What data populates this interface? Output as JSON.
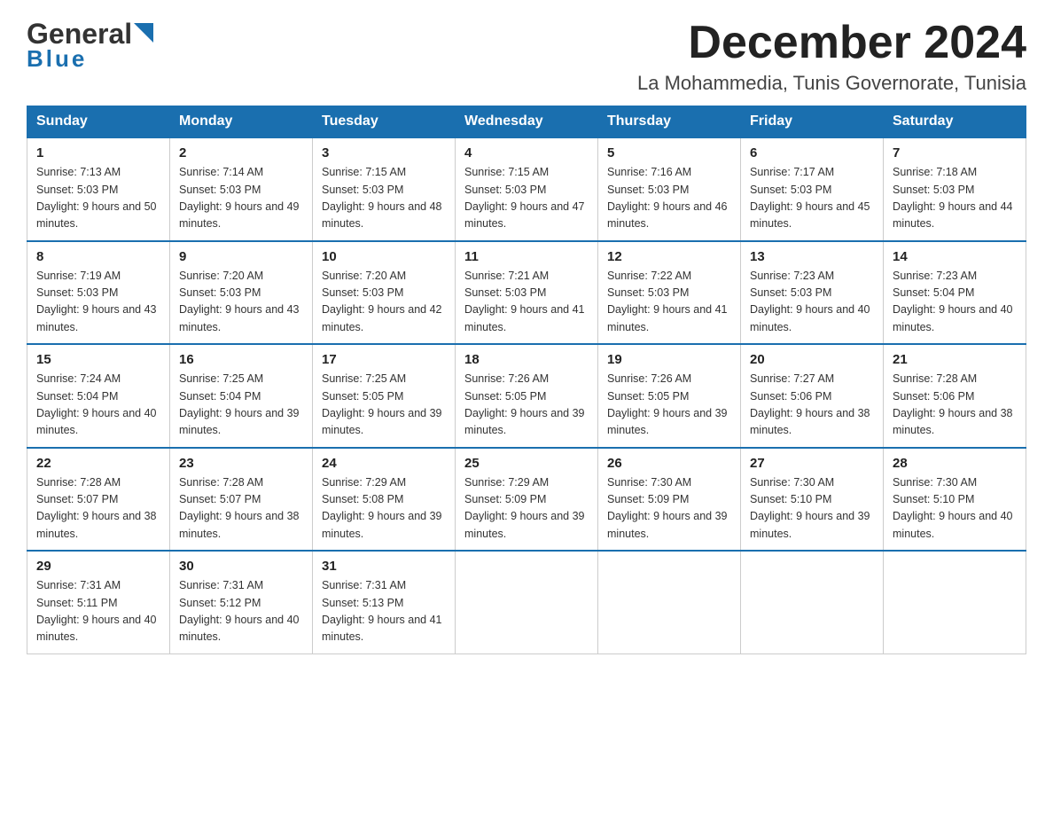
{
  "header": {
    "logo_general": "General",
    "logo_blue": "Blue",
    "month_title": "December 2024",
    "location": "La Mohammedia, Tunis Governorate, Tunisia"
  },
  "days_of_week": [
    "Sunday",
    "Monday",
    "Tuesday",
    "Wednesday",
    "Thursday",
    "Friday",
    "Saturday"
  ],
  "weeks": [
    [
      {
        "day": "1",
        "sunrise": "7:13 AM",
        "sunset": "5:03 PM",
        "daylight": "9 hours and 50 minutes."
      },
      {
        "day": "2",
        "sunrise": "7:14 AM",
        "sunset": "5:03 PM",
        "daylight": "9 hours and 49 minutes."
      },
      {
        "day": "3",
        "sunrise": "7:15 AM",
        "sunset": "5:03 PM",
        "daylight": "9 hours and 48 minutes."
      },
      {
        "day": "4",
        "sunrise": "7:15 AM",
        "sunset": "5:03 PM",
        "daylight": "9 hours and 47 minutes."
      },
      {
        "day": "5",
        "sunrise": "7:16 AM",
        "sunset": "5:03 PM",
        "daylight": "9 hours and 46 minutes."
      },
      {
        "day": "6",
        "sunrise": "7:17 AM",
        "sunset": "5:03 PM",
        "daylight": "9 hours and 45 minutes."
      },
      {
        "day": "7",
        "sunrise": "7:18 AM",
        "sunset": "5:03 PM",
        "daylight": "9 hours and 44 minutes."
      }
    ],
    [
      {
        "day": "8",
        "sunrise": "7:19 AM",
        "sunset": "5:03 PM",
        "daylight": "9 hours and 43 minutes."
      },
      {
        "day": "9",
        "sunrise": "7:20 AM",
        "sunset": "5:03 PM",
        "daylight": "9 hours and 43 minutes."
      },
      {
        "day": "10",
        "sunrise": "7:20 AM",
        "sunset": "5:03 PM",
        "daylight": "9 hours and 42 minutes."
      },
      {
        "day": "11",
        "sunrise": "7:21 AM",
        "sunset": "5:03 PM",
        "daylight": "9 hours and 41 minutes."
      },
      {
        "day": "12",
        "sunrise": "7:22 AM",
        "sunset": "5:03 PM",
        "daylight": "9 hours and 41 minutes."
      },
      {
        "day": "13",
        "sunrise": "7:23 AM",
        "sunset": "5:03 PM",
        "daylight": "9 hours and 40 minutes."
      },
      {
        "day": "14",
        "sunrise": "7:23 AM",
        "sunset": "5:04 PM",
        "daylight": "9 hours and 40 minutes."
      }
    ],
    [
      {
        "day": "15",
        "sunrise": "7:24 AM",
        "sunset": "5:04 PM",
        "daylight": "9 hours and 40 minutes."
      },
      {
        "day": "16",
        "sunrise": "7:25 AM",
        "sunset": "5:04 PM",
        "daylight": "9 hours and 39 minutes."
      },
      {
        "day": "17",
        "sunrise": "7:25 AM",
        "sunset": "5:05 PM",
        "daylight": "9 hours and 39 minutes."
      },
      {
        "day": "18",
        "sunrise": "7:26 AM",
        "sunset": "5:05 PM",
        "daylight": "9 hours and 39 minutes."
      },
      {
        "day": "19",
        "sunrise": "7:26 AM",
        "sunset": "5:05 PM",
        "daylight": "9 hours and 39 minutes."
      },
      {
        "day": "20",
        "sunrise": "7:27 AM",
        "sunset": "5:06 PM",
        "daylight": "9 hours and 38 minutes."
      },
      {
        "day": "21",
        "sunrise": "7:28 AM",
        "sunset": "5:06 PM",
        "daylight": "9 hours and 38 minutes."
      }
    ],
    [
      {
        "day": "22",
        "sunrise": "7:28 AM",
        "sunset": "5:07 PM",
        "daylight": "9 hours and 38 minutes."
      },
      {
        "day": "23",
        "sunrise": "7:28 AM",
        "sunset": "5:07 PM",
        "daylight": "9 hours and 38 minutes."
      },
      {
        "day": "24",
        "sunrise": "7:29 AM",
        "sunset": "5:08 PM",
        "daylight": "9 hours and 39 minutes."
      },
      {
        "day": "25",
        "sunrise": "7:29 AM",
        "sunset": "5:09 PM",
        "daylight": "9 hours and 39 minutes."
      },
      {
        "day": "26",
        "sunrise": "7:30 AM",
        "sunset": "5:09 PM",
        "daylight": "9 hours and 39 minutes."
      },
      {
        "day": "27",
        "sunrise": "7:30 AM",
        "sunset": "5:10 PM",
        "daylight": "9 hours and 39 minutes."
      },
      {
        "day": "28",
        "sunrise": "7:30 AM",
        "sunset": "5:10 PM",
        "daylight": "9 hours and 40 minutes."
      }
    ],
    [
      {
        "day": "29",
        "sunrise": "7:31 AM",
        "sunset": "5:11 PM",
        "daylight": "9 hours and 40 minutes."
      },
      {
        "day": "30",
        "sunrise": "7:31 AM",
        "sunset": "5:12 PM",
        "daylight": "9 hours and 40 minutes."
      },
      {
        "day": "31",
        "sunrise": "7:31 AM",
        "sunset": "5:13 PM",
        "daylight": "9 hours and 41 minutes."
      },
      null,
      null,
      null,
      null
    ]
  ]
}
